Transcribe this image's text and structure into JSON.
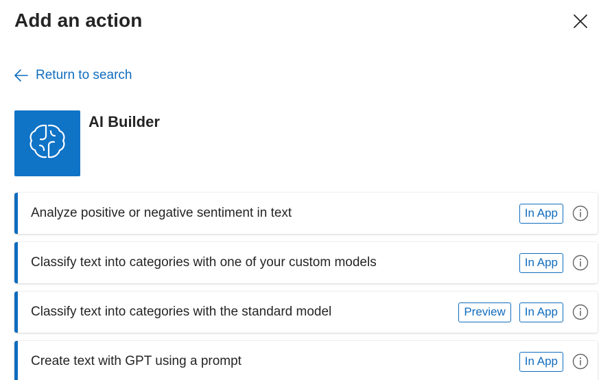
{
  "header": {
    "title": "Add an action",
    "close_icon": "close-icon"
  },
  "back_link": {
    "label": "Return to search",
    "icon": "arrow-left-icon"
  },
  "connector": {
    "name": "AI Builder",
    "logo_icon": "brain-icon",
    "logo_color": "#0f73c6"
  },
  "actions": [
    {
      "label": "Analyze positive or negative sentiment in text",
      "badges": [
        "In App"
      ]
    },
    {
      "label": "Classify text into categories with one of your custom models",
      "badges": [
        "In App"
      ]
    },
    {
      "label": "Classify text into categories with the standard model",
      "badges": [
        "Preview",
        "In App"
      ]
    },
    {
      "label": "Create text with GPT using a prompt",
      "badges": [
        "In App"
      ]
    }
  ],
  "colors": {
    "accent": "#0f6cbd",
    "text": "#242424",
    "icon_gray": "#616161"
  }
}
